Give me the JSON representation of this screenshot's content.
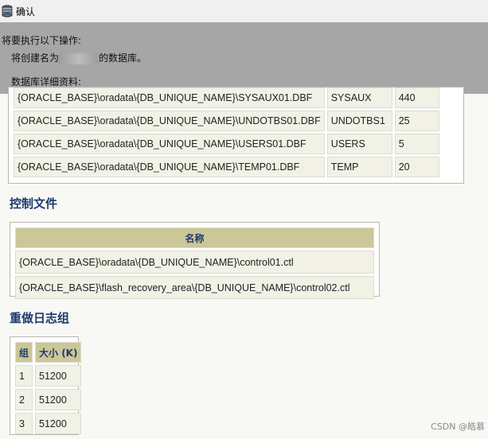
{
  "window": {
    "title": "确认"
  },
  "banner": {
    "line1": "将要执行以下操作:",
    "line2_prefix": "将创建名为",
    "line2_suffix": "的数据库。",
    "line3": "数据库详细资料:"
  },
  "datafiles": {
    "rows": [
      {
        "path": "{ORACLE_BASE}\\oradata\\{DB_UNIQUE_NAME}\\SYSAUX01.DBF",
        "tablespace": "SYSAUX",
        "size": "440"
      },
      {
        "path": "{ORACLE_BASE}\\oradata\\{DB_UNIQUE_NAME}\\UNDOTBS01.DBF",
        "tablespace": "UNDOTBS1",
        "size": "25"
      },
      {
        "path": "{ORACLE_BASE}\\oradata\\{DB_UNIQUE_NAME}\\USERS01.DBF",
        "tablespace": "USERS",
        "size": "5"
      },
      {
        "path": "{ORACLE_BASE}\\oradata\\{DB_UNIQUE_NAME}\\TEMP01.DBF",
        "tablespace": "TEMP",
        "size": "20"
      }
    ]
  },
  "control_files": {
    "title": "控制文件",
    "header": "名称",
    "rows": [
      "{ORACLE_BASE}\\oradata\\{DB_UNIQUE_NAME}\\control01.ctl",
      "{ORACLE_BASE}\\flash_recovery_area\\{DB_UNIQUE_NAME}\\control02.ctl"
    ]
  },
  "redo_logs": {
    "title": "重做日志组",
    "headers": [
      "组",
      "大小 (K)"
    ],
    "rows": [
      {
        "group": "1",
        "size": "51200"
      },
      {
        "group": "2",
        "size": "51200"
      },
      {
        "group": "3",
        "size": "51200"
      }
    ]
  },
  "watermark": "CSDN @皓慕"
}
